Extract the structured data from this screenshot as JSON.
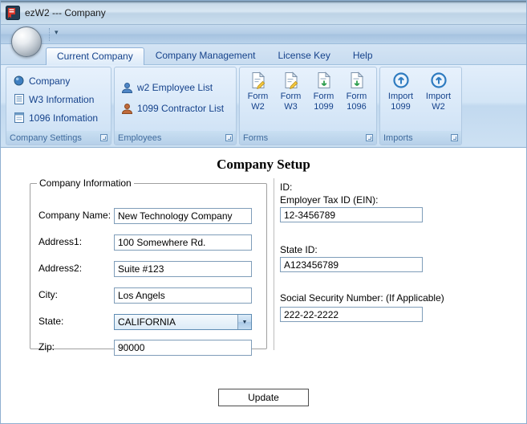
{
  "window": {
    "title": "ezW2 --- Company"
  },
  "tabs": {
    "items": [
      {
        "label": "Current Company"
      },
      {
        "label": "Company Management"
      },
      {
        "label": "License Key"
      },
      {
        "label": "Help"
      }
    ]
  },
  "ribbon": {
    "company_settings": {
      "caption": "Company Settings",
      "items": [
        {
          "label": "Company"
        },
        {
          "label": "W3 Information"
        },
        {
          "label": "1096 Infomation"
        }
      ]
    },
    "employees": {
      "caption": "Employees",
      "items": [
        {
          "label": "w2 Employee List"
        },
        {
          "label": "1099 Contractor List"
        }
      ]
    },
    "forms": {
      "caption": "Forms",
      "items": [
        {
          "line1": "Form",
          "line2": "W2"
        },
        {
          "line1": "Form",
          "line2": "W3"
        },
        {
          "line1": "Form",
          "line2": "1099"
        },
        {
          "line1": "Form",
          "line2": "1096"
        }
      ]
    },
    "imports": {
      "caption": "Imports",
      "items": [
        {
          "line1": "Import",
          "line2": "1099"
        },
        {
          "line1": "Import",
          "line2": "W2"
        }
      ]
    }
  },
  "main": {
    "title": "Company Setup",
    "company_info": {
      "legend": "Company Information",
      "company_name": {
        "label": "Company Name:",
        "value": "New Technology Company"
      },
      "address1": {
        "label": "Address1:",
        "value": "100 Somewhere Rd."
      },
      "address2": {
        "label": "Address2:",
        "value": "Suite #123"
      },
      "city": {
        "label": "City:",
        "value": "Los Angels"
      },
      "state": {
        "label": "State:",
        "value": "CALIFORNIA"
      },
      "zip": {
        "label": "Zip:",
        "value": "90000"
      }
    },
    "ids": {
      "heading": "ID:",
      "ein": {
        "label": "Employer Tax ID (EIN):",
        "value": "12-3456789"
      },
      "state_id": {
        "label": "State ID:",
        "value": "A123456789"
      },
      "ssn": {
        "label": "Social Security Number: (If Applicable)",
        "value": "222-22-2222"
      }
    },
    "update_button": "Update"
  },
  "colors": {
    "ribbon_text": "#15428b",
    "input_border": "#7f9db9",
    "app_icon_red": "#d83427"
  }
}
